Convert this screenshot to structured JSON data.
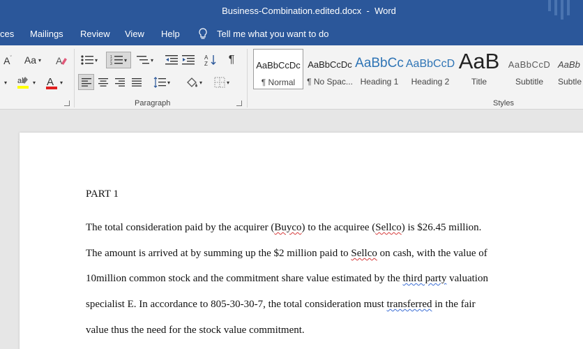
{
  "window": {
    "document_name": "Business-Combination.edited.docx",
    "separator": "-",
    "app_name": "Word"
  },
  "tabs": {
    "references_partial": "ces",
    "mailings": "Mailings",
    "review": "Review",
    "view": "View",
    "help": "Help",
    "tell_me": "Tell me what you want to do"
  },
  "ribbon": {
    "paragraph_group": "Paragraph",
    "styles_group": "Styles",
    "font_size_glyph": "A",
    "change_case_glyph": "Aa",
    "font_color_glyph": "A",
    "highlight_glyph": "ab",
    "pilcrow": "¶",
    "colors": {
      "font_color": "#e02020",
      "highlight": "#ffff00"
    },
    "styles": [
      {
        "sample": "AaBbCcDc",
        "name": "¶ Normal",
        "selected": true
      },
      {
        "sample": "AaBbCcDc",
        "name": "¶ No Spac...",
        "selected": false
      },
      {
        "sample": "AaBbCc",
        "name": "Heading 1",
        "selected": false
      },
      {
        "sample": "AaBbCcD",
        "name": "Heading 2",
        "selected": false
      },
      {
        "sample": "AaB",
        "name": "Title",
        "selected": false
      },
      {
        "sample": "AaBbCcD",
        "name": "Subtitle",
        "selected": false
      },
      {
        "sample": "AaBb",
        "name": "Subtle",
        "selected": false
      }
    ]
  },
  "document": {
    "heading": "PART 1",
    "line1": {
      "a": "The total consideration paid by the acquirer (",
      "b": "Buyco",
      "c": ") to the acquiree (",
      "d": "Sellco",
      "e": ") is $26.45 million."
    },
    "line2": {
      "a": "The amount is arrived at by summing up the $2 million paid to ",
      "b": "Sellco",
      "c": " on cash, with the value of"
    },
    "line3": {
      "a": "10million common stock and the commitment share value estimated by the ",
      "b": "third party",
      "c": " valuation"
    },
    "line4": {
      "a": "specialist E. In accordance to 805-30-30-7, the total consideration must ",
      "b": "transferred",
      "c": " in the fair"
    },
    "line5": "value thus the need for the stock value commitment."
  }
}
